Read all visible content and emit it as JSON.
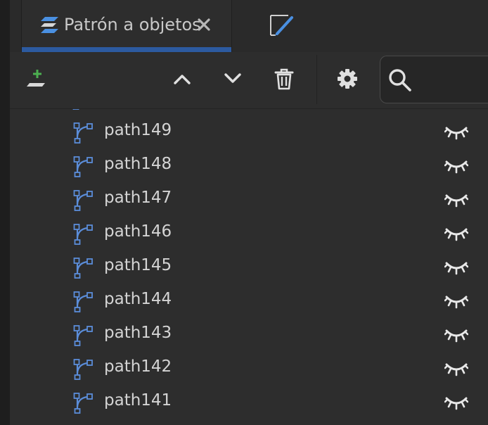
{
  "tabs": {
    "active": {
      "label": "Patrón a objetos",
      "icon": "objects-layers-icon"
    },
    "second": {
      "icon": "fill-stroke-icon"
    }
  },
  "toolbar": {
    "add_icon": "add-layer-icon",
    "move_up_icon": "chevron-up-icon",
    "move_down_icon": "chevron-down-icon",
    "delete_icon": "trash-icon",
    "settings_icon": "gear-icon",
    "search": {
      "icon": "search-icon",
      "value": "",
      "placeholder": ""
    }
  },
  "colors": {
    "accent": "#2c5aa0",
    "path_icon": "#5b8dd9",
    "add_green": "#4caf50",
    "text": "#d4d4d4"
  },
  "rows": [
    {
      "label": "path149",
      "icon": "path-icon",
      "visibility": "hidden"
    },
    {
      "label": "path148",
      "icon": "path-icon",
      "visibility": "hidden"
    },
    {
      "label": "path147",
      "icon": "path-icon",
      "visibility": "hidden"
    },
    {
      "label": "path146",
      "icon": "path-icon",
      "visibility": "hidden"
    },
    {
      "label": "path145",
      "icon": "path-icon",
      "visibility": "hidden"
    },
    {
      "label": "path144",
      "icon": "path-icon",
      "visibility": "hidden"
    },
    {
      "label": "path143",
      "icon": "path-icon",
      "visibility": "hidden"
    },
    {
      "label": "path142",
      "icon": "path-icon",
      "visibility": "hidden"
    },
    {
      "label": "path141",
      "icon": "path-icon",
      "visibility": "hidden"
    }
  ]
}
